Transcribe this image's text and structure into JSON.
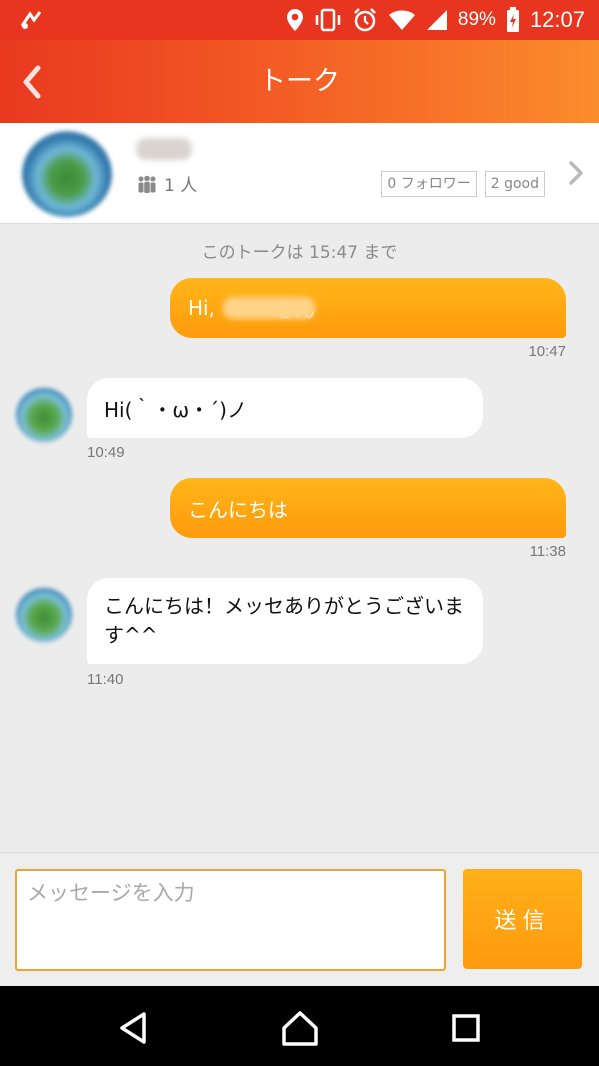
{
  "status_bar": {
    "battery_percent": "89%",
    "time": "12:07",
    "icons": [
      "location-icon",
      "vibrate-icon",
      "alarm-icon",
      "wifi-icon",
      "signal-icon",
      "battery-charging-icon"
    ]
  },
  "app_bar": {
    "title": "トーク",
    "back_icon": "chevron-left-icon"
  },
  "profile": {
    "member_count": "1 人",
    "followers": "0 フォロワー",
    "good": "2 good"
  },
  "chat": {
    "notice": "このトークは 15:47 まで",
    "messages": [
      {
        "direction": "out",
        "text": "Hi,",
        "text_suffix": "さん",
        "time": "10:47"
      },
      {
        "direction": "in",
        "text": "Hi(｀・ω・´)ノ",
        "time": "10:49"
      },
      {
        "direction": "out",
        "text": "こんにちは",
        "time": "11:38"
      },
      {
        "direction": "in",
        "text": "こんにちは！メッセありがとうございます^^",
        "time": "11:40"
      }
    ]
  },
  "composer": {
    "placeholder": "メッセージを入力",
    "send_label": "送信"
  },
  "colors": {
    "header_start": "#e8391f",
    "header_end": "#fb8c2c",
    "bubble_out": "#ffa612",
    "input_border": "#e8a535"
  }
}
